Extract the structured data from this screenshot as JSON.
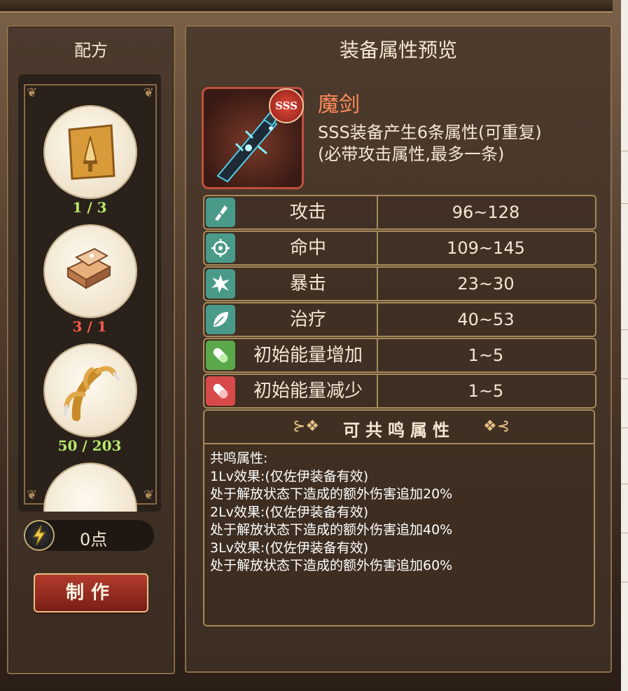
{
  "recipe_panel": {
    "title": "配方",
    "materials": [
      {
        "icon": "sword-scroll-icon",
        "count": "1 / 3",
        "count_color": "#b8e86a"
      },
      {
        "icon": "ingot-icon",
        "count": "3 / 1",
        "count_color": "#ff5a4a"
      },
      {
        "icon": "claw-icon",
        "count": "50 / 203",
        "count_color": "#b8e86a"
      }
    ],
    "energy": "0点",
    "craft_button": "制作"
  },
  "preview_panel": {
    "title": "装备属性预览",
    "item": {
      "name": "魔剑",
      "rank": "SSS",
      "desc_line1": "SSS装备产生6条属性(可重复)",
      "desc_line2": "(必带攻击属性,最多一条)"
    },
    "attributes": [
      {
        "icon": "attack-icon",
        "icon_bg": "#4a9a8a",
        "name": "攻击",
        "range": "96~128"
      },
      {
        "icon": "target-icon",
        "icon_bg": "#4a9a8a",
        "name": "命中",
        "range": "109~145"
      },
      {
        "icon": "crit-icon",
        "icon_bg": "#4a9a8a",
        "name": "暴击",
        "range": "23~30"
      },
      {
        "icon": "leaf-icon",
        "icon_bg": "#4a9a8a",
        "name": "治疗",
        "range": "40~53"
      },
      {
        "icon": "energy-up-capsule-icon",
        "icon_bg": "#5aa84a",
        "name": "初始能量增加",
        "range": "1~5"
      },
      {
        "icon": "energy-down-capsule-icon",
        "icon_bg": "#d84a4a",
        "name": "初始能量减少",
        "range": "1~5"
      }
    ],
    "resonance": {
      "title": "可共鸣属性",
      "lines": [
        "共鸣属性:",
        "1Lv效果:(仅佐伊装备有效)",
        "处于解放状态下造成的额外伤害追加20%",
        "2Lv效果:(仅佐伊装备有效)",
        "处于解放状态下造成的额外伤害追加40%",
        "3Lv效果:(仅佐伊装备有效)",
        "处于解放状态下造成的额外伤害追加60%"
      ]
    }
  }
}
